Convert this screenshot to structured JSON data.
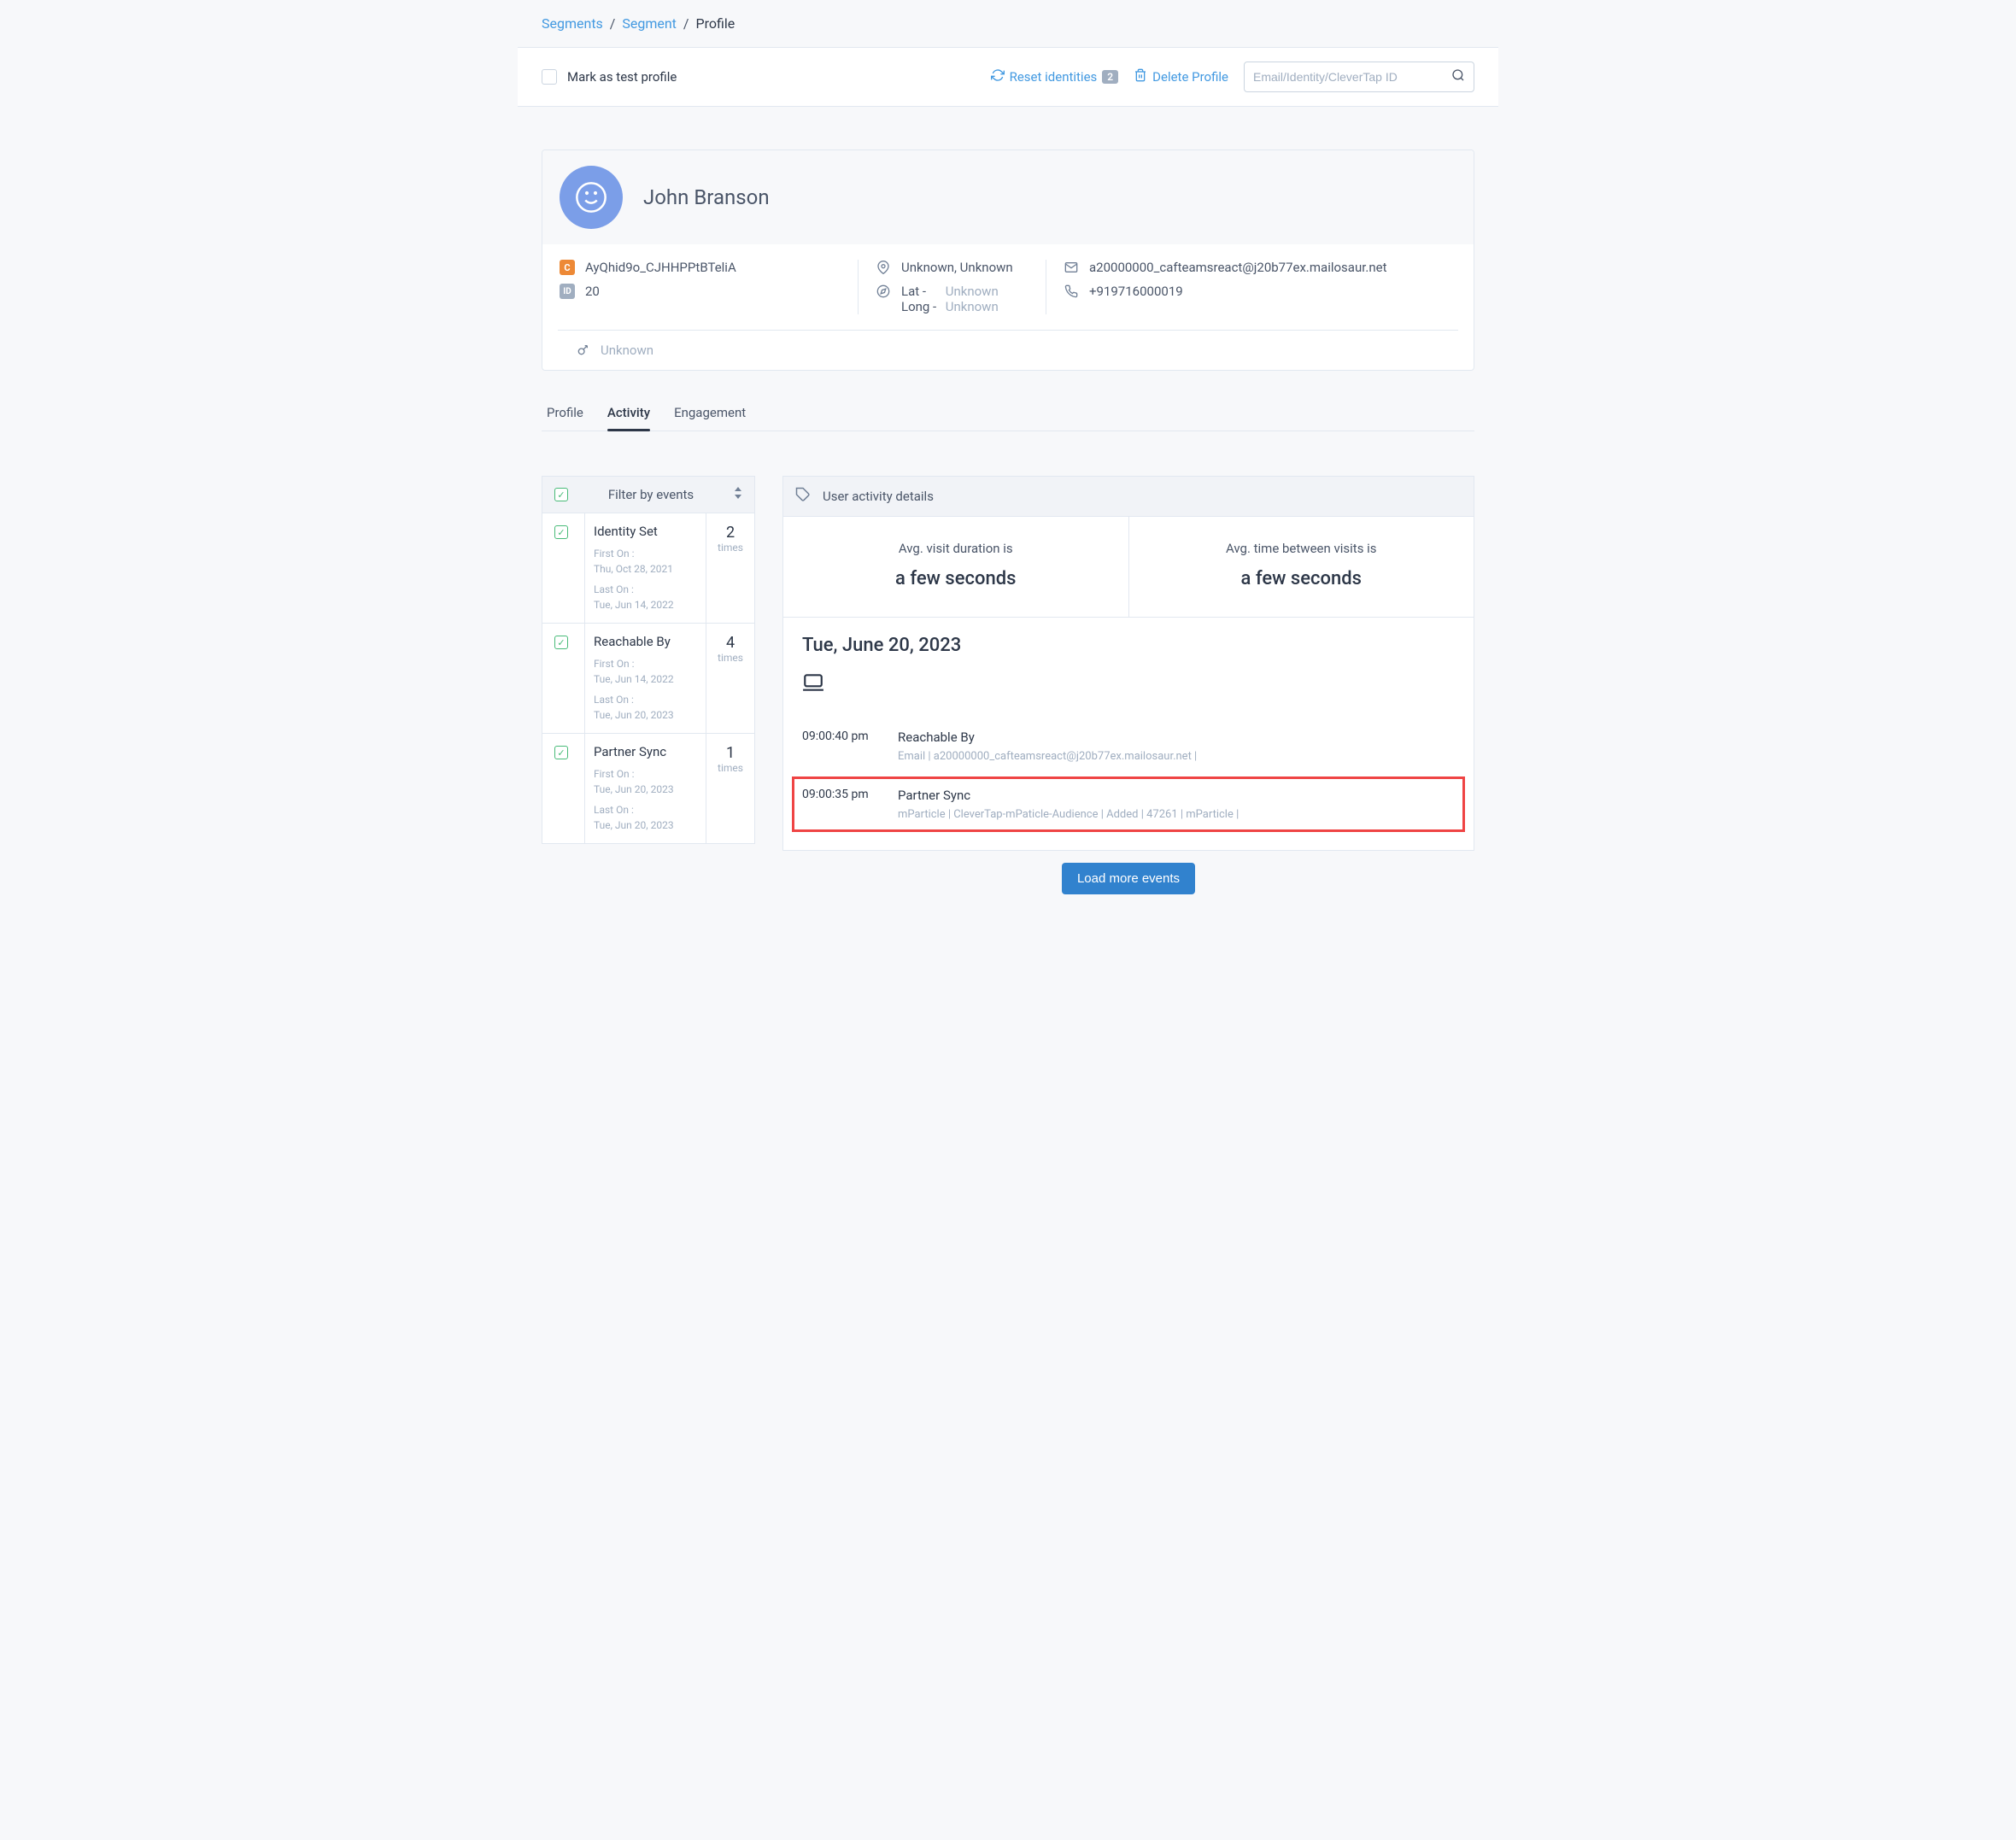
{
  "breadcrumb": {
    "segments": "Segments",
    "segment": "Segment",
    "profile": "Profile"
  },
  "actionBar": {
    "markTestLabel": "Mark as test profile",
    "resetIdentities": "Reset identities",
    "resetCount": "2",
    "deleteProfile": "Delete Profile",
    "searchPlaceholder": "Email/Identity/CleverTap ID"
  },
  "profile": {
    "name": "John Branson",
    "cid": "AyQhid9o_CJHHPPtBTeliA",
    "id": "20",
    "location": "Unknown, Unknown",
    "latLabel": "Lat -",
    "latValue": "Unknown",
    "longLabel": "Long -",
    "longValue": "Unknown",
    "email": "a20000000_cafteamsreact@j20b77ex.mailosaur.net",
    "phone": "+919716000019",
    "gender": "Unknown"
  },
  "tabs": {
    "profile": "Profile",
    "activity": "Activity",
    "engagement": "Engagement"
  },
  "filter": {
    "title": "Filter by events",
    "events": [
      {
        "name": "Identity Set",
        "firstOnLabel": "First On :",
        "firstOn": "Thu, Oct 28, 2021",
        "lastOnLabel": "Last On :",
        "lastOn": "Tue, Jun 14, 2022",
        "count": "2",
        "countLabel": "times"
      },
      {
        "name": "Reachable By",
        "firstOnLabel": "First On :",
        "firstOn": "Tue, Jun 14, 2022",
        "lastOnLabel": "Last On :",
        "lastOn": "Tue, Jun 20, 2023",
        "count": "4",
        "countLabel": "times"
      },
      {
        "name": "Partner Sync",
        "firstOnLabel": "First On :",
        "firstOn": "Tue, Jun 20, 2023",
        "lastOnLabel": "Last On :",
        "lastOn": "Tue, Jun 20, 2023",
        "count": "1",
        "countLabel": "times"
      }
    ]
  },
  "activity": {
    "header": "User activity details",
    "avgVisitLabel": "Avg. visit duration is",
    "avgVisitValue": "a few seconds",
    "avgTimeBetweenLabel": "Avg. time between visits is",
    "avgTimeBetweenValue": "a few seconds",
    "date": "Tue, June 20, 2023",
    "items": [
      {
        "time": "09:00:40 pm",
        "title": "Reachable By",
        "meta": "Email  |  a20000000_cafteamsreact@j20b77ex.mailosaur.net  |"
      },
      {
        "time": "09:00:35 pm",
        "title": "Partner Sync",
        "meta": "mParticle  |  CleverTap-mPaticle-Audience  |  Added  |  47261  |  mParticle  |"
      }
    ]
  },
  "loadMore": "Load more events"
}
